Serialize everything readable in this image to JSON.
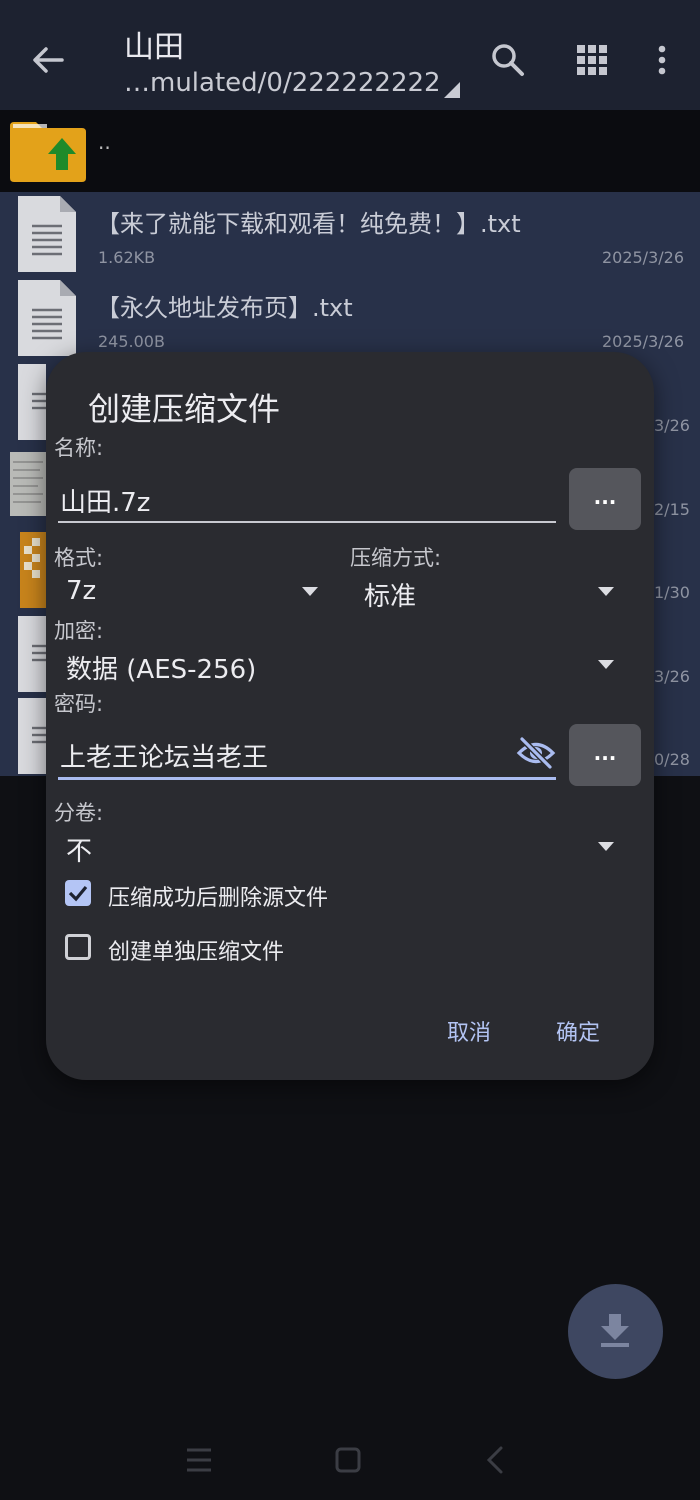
{
  "header": {
    "title": "山田",
    "path": "…mulated/0/222222222"
  },
  "parent_row": {
    "label": ".."
  },
  "files": [
    {
      "name": "【来了就能下载和观看！纯免费！】.txt",
      "size": "1.62KB",
      "date": "2025/3/26"
    },
    {
      "name": "【永久地址发布页】.txt",
      "size": "245.00B",
      "date": "2025/3/26"
    }
  ],
  "partial_dates": [
    "3/26",
    "2/15",
    "1/30",
    "3/26",
    "0/28"
  ],
  "dialog": {
    "title": "创建压缩文件",
    "name_label": "名称:",
    "name_value": "山田.7z",
    "browse_label": "...",
    "format_label": "格式:",
    "format_value": "7z",
    "method_label": "压缩方式:",
    "method_value": "标准",
    "encrypt_label": "加密:",
    "encrypt_value": "数据 (AES-256)",
    "password_label": "密码:",
    "password_value": "上老王论坛当老王",
    "password_more_label": "...",
    "split_label": "分卷:",
    "split_value": "不",
    "delete_source_label": "压缩成功后删除源文件",
    "delete_source_checked": true,
    "separate_archive_label": "创建单独压缩文件",
    "separate_archive_checked": false,
    "cancel_label": "取消",
    "ok_label": "确定"
  },
  "colors": {
    "accent": "#b4c5f5",
    "dialog_bg": "#2a2b30",
    "list_selected_bg": "#283149",
    "header_bg": "#1d2230"
  },
  "icons": [
    "back-arrow-icon",
    "search-icon",
    "grid-view-icon",
    "more-vert-icon",
    "folder-up-icon",
    "document-icon",
    "visibility-off-icon",
    "download-icon"
  ]
}
